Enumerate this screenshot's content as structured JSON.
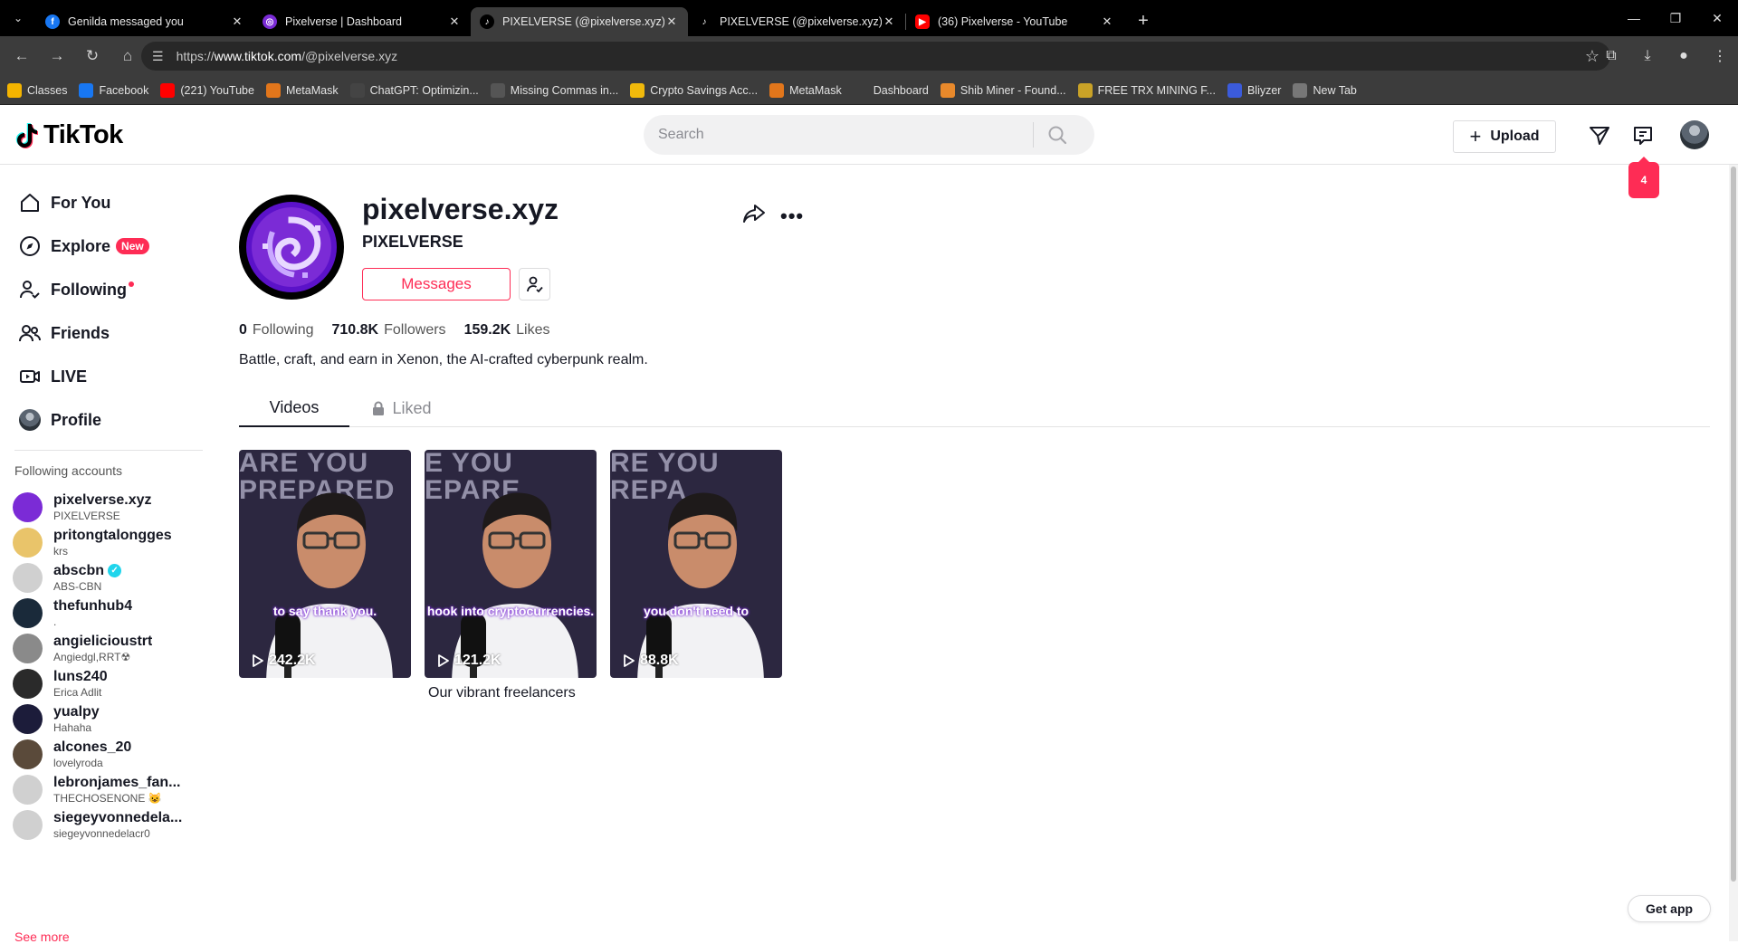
{
  "browser": {
    "tabs": [
      {
        "title": "Genilda messaged you",
        "favicon": "facebook-icon",
        "color": "#1877f2"
      },
      {
        "title": "Pixelverse | Dashboard",
        "favicon": "pixelverse-icon",
        "color": "#7b2bd6"
      },
      {
        "title": "PIXELVERSE (@pixelverse.xyz) | TikTok",
        "favicon": "tiktok-icon",
        "color": "#000000"
      },
      {
        "title": "PIXELVERSE (@pixelverse.xyz) | TikTok",
        "favicon": "tiktok-icon",
        "color": "#000000"
      },
      {
        "title": "(36) Pixelverse - YouTube",
        "favicon": "youtube-icon",
        "color": "#ff0000"
      }
    ],
    "url_prefix": "https://",
    "url_host": "www.tiktok.com",
    "url_path": "/@pixelverse.xyz",
    "bookmarks": [
      {
        "label": "Classes",
        "color": "#f4b400"
      },
      {
        "label": "Facebook",
        "color": "#1877f2"
      },
      {
        "label": "(221) YouTube",
        "color": "#ff0000"
      },
      {
        "label": "MetaMask",
        "color": "#e2761b"
      },
      {
        "label": "ChatGPT: Optimizin...",
        "color": "#444444"
      },
      {
        "label": "Missing Commas in...",
        "color": "#555555"
      },
      {
        "label": "Crypto Savings Acc...",
        "color": "#f0b90b"
      },
      {
        "label": "MetaMask",
        "color": "#e2761b"
      },
      {
        "label": "Dashboard",
        "color": "#3c3c3c"
      },
      {
        "label": "Shib Miner - Found...",
        "color": "#e8892b"
      },
      {
        "label": "FREE TRX MINING F...",
        "color": "#c9a227"
      },
      {
        "label": "Bliyzer",
        "color": "#3b5bdb"
      },
      {
        "label": "New Tab",
        "color": "#777777"
      }
    ]
  },
  "header": {
    "logo_text": "TikTok",
    "search_placeholder": "Search",
    "upload_label": "Upload",
    "inbox_badge": "4"
  },
  "sidebar": {
    "nav": [
      {
        "label": "For You",
        "icon": "home-icon"
      },
      {
        "label": "Explore",
        "icon": "compass-icon",
        "badge": "New"
      },
      {
        "label": "Following",
        "icon": "following-icon"
      },
      {
        "label": "Friends",
        "icon": "friends-icon"
      },
      {
        "label": "LIVE",
        "icon": "live-icon"
      },
      {
        "label": "Profile",
        "icon": "avatar"
      }
    ],
    "following_title": "Following accounts",
    "accounts": [
      {
        "name": "pixelverse.xyz",
        "sub": "PIXELVERSE",
        "color": "#7b2bd6"
      },
      {
        "name": "pritongtalongges",
        "sub": "krs",
        "color": "#e9c46a"
      },
      {
        "name": "abscbn",
        "sub": "ABS-CBN",
        "color": "#d0d0d0",
        "verified": true
      },
      {
        "name": "thefunhub4",
        "sub": ".",
        "color": "#1a2a3a"
      },
      {
        "name": "angielicioustrt",
        "sub": "Angiedgl,RRT☢",
        "color": "#8a8a8a"
      },
      {
        "name": "luns240",
        "sub": "Erica Adlit",
        "color": "#2a2a2a"
      },
      {
        "name": "yualpy",
        "sub": "Hahaha",
        "color": "#1c1c3a"
      },
      {
        "name": "alcones_20",
        "sub": "lovelyroda",
        "color": "#5a4a3a"
      },
      {
        "name": "lebronjames_fan...",
        "sub": "THECHOSENONE 😺",
        "color": "#d0d0d0"
      },
      {
        "name": "siegeyvonnedela...",
        "sub": "siegeyvonnedelacr0",
        "color": "#d0d0d0"
      }
    ],
    "see_more": "See more"
  },
  "profile": {
    "username": "pixelverse.xyz",
    "nickname": "PIXELVERSE",
    "messages_label": "Messages",
    "following_count": "0",
    "following_label": "Following",
    "followers_count": "710.8K",
    "followers_label": "Followers",
    "likes_count": "159.2K",
    "likes_label": "Likes",
    "bio": "Battle, craft, and earn in Xenon, the AI-crafted cyberpunk realm.",
    "tab_videos": "Videos",
    "tab_liked": "Liked",
    "videos": [
      {
        "caption": "to say thank you.",
        "views": "242.2K",
        "bg_text": "ARE YOU PREPARED"
      },
      {
        "caption": "hook into cryptocurrencies.",
        "views": "121.2K",
        "bg_text": "E YOU EPARE"
      },
      {
        "caption": "you don't need to",
        "views": "88.8K",
        "bg_text": "RE YOU REPA"
      }
    ],
    "video_title": "Our vibrant freelancers"
  },
  "get_app_label": "Get app"
}
